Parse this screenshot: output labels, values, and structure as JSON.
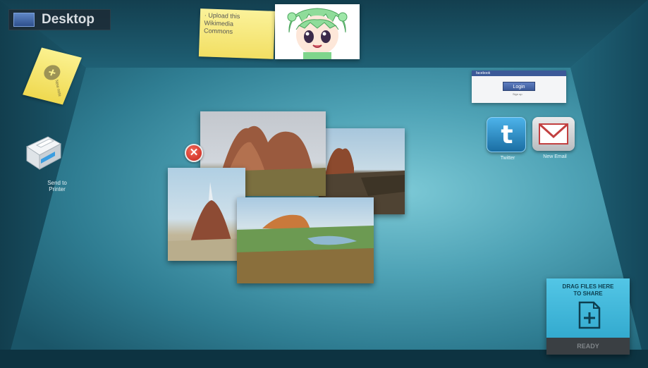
{
  "header": {
    "title": "Desktop",
    "icon": "desktop-icon"
  },
  "sticky_note_top": {
    "text": "· Upload this\nWikimedia\nCommons"
  },
  "sticky_note_left": {
    "label": "New note",
    "icon": "plus-circle-icon"
  },
  "printer": {
    "label": "Send to\nPrinter",
    "icon": "printer-icon"
  },
  "facebook": {
    "header": "facebook",
    "login_label": "Login",
    "sub": "Sign up"
  },
  "twitter": {
    "label": "Twitter",
    "icon": "twitter-icon",
    "glyph": "t"
  },
  "email": {
    "label": "New Email",
    "icon": "envelope-icon"
  },
  "photos": {
    "close_glyph": "✕"
  },
  "share": {
    "text": "DRAG FILES HERE\nTO SHARE",
    "status": "READY",
    "icon": "document-plus-icon"
  },
  "colors": {
    "room": "#2f7d92",
    "accent_share": "#3ab5da",
    "close": "#d42a1f",
    "facebook": "#3b5998"
  }
}
